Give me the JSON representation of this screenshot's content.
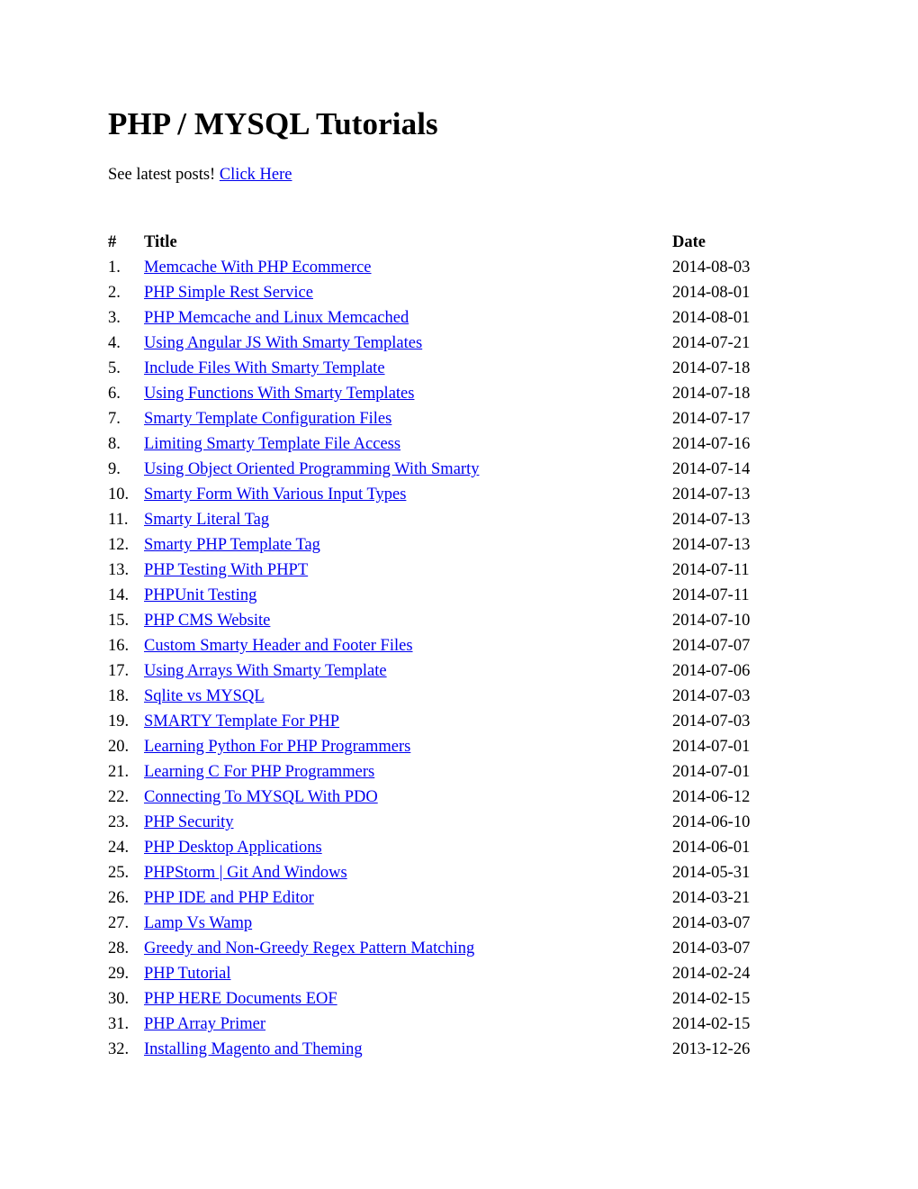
{
  "page": {
    "title": "PHP / MYSQL Tutorials",
    "subtitle_text": "See latest posts!",
    "subtitle_link_label": "Click Here"
  },
  "colors": {
    "link": "#0000EE",
    "text": "#000000",
    "background": "#FFFFFF"
  },
  "table": {
    "headers": {
      "num": "#",
      "title": "Title",
      "date": "Date"
    },
    "rows": [
      {
        "num": "1.",
        "title": "Memcache With PHP Ecommerce",
        "date": "2014-08-03"
      },
      {
        "num": "2.",
        "title": "PHP Simple Rest Service",
        "date": "2014-08-01"
      },
      {
        "num": "3.",
        "title": "PHP Memcache and Linux Memcached",
        "date": "2014-08-01"
      },
      {
        "num": "4.",
        "title": "Using Angular JS With Smarty Templates",
        "date": "2014-07-21"
      },
      {
        "num": "5.",
        "title": "Include Files With Smarty Template",
        "date": "2014-07-18"
      },
      {
        "num": "6.",
        "title": "Using Functions With Smarty Templates",
        "date": "2014-07-18"
      },
      {
        "num": "7.",
        "title": "Smarty Template Configuration Files",
        "date": "2014-07-17"
      },
      {
        "num": "8.",
        "title": "Limiting Smarty Template File Access",
        "date": "2014-07-16"
      },
      {
        "num": "9.",
        "title": "Using Object Oriented Programming With Smarty",
        "date": "2014-07-14"
      },
      {
        "num": "10.",
        "title": "Smarty Form With Various Input Types",
        "date": "2014-07-13"
      },
      {
        "num": "11.",
        "title": "Smarty Literal Tag",
        "date": "2014-07-13"
      },
      {
        "num": "12.",
        "title": "Smarty PHP Template Tag",
        "date": "2014-07-13"
      },
      {
        "num": "13.",
        "title": "PHP Testing With PHPT",
        "date": "2014-07-11"
      },
      {
        "num": "14.",
        "title": "PHPUnit Testing",
        "date": "2014-07-11"
      },
      {
        "num": "15.",
        "title": "PHP CMS Website",
        "date": "2014-07-10"
      },
      {
        "num": "16.",
        "title": "Custom Smarty Header and Footer Files",
        "date": "2014-07-07"
      },
      {
        "num": "17.",
        "title": "Using Arrays With Smarty Template",
        "date": "2014-07-06"
      },
      {
        "num": "18.",
        "title": "Sqlite vs MYSQL",
        "date": "2014-07-03"
      },
      {
        "num": "19.",
        "title": "SMARTY Template For PHP",
        "date": "2014-07-03"
      },
      {
        "num": "20.",
        "title": "Learning Python For PHP Programmers",
        "date": "2014-07-01"
      },
      {
        "num": "21.",
        "title": "Learning C For PHP Programmers",
        "date": "2014-07-01"
      },
      {
        "num": "22.",
        "title": "Connecting To MYSQL With PDO",
        "date": "2014-06-12"
      },
      {
        "num": "23.",
        "title": "PHP Security",
        "date": "2014-06-10"
      },
      {
        "num": "24.",
        "title": "PHP Desktop Applications",
        "date": "2014-06-01"
      },
      {
        "num": "25.",
        "title": "PHPStorm | Git And Windows",
        "date": "2014-05-31"
      },
      {
        "num": "26.",
        "title": "PHP IDE and PHP Editor",
        "date": "2014-03-21"
      },
      {
        "num": "27.",
        "title": "Lamp Vs Wamp",
        "date": "2014-03-07"
      },
      {
        "num": "28.",
        "title": "Greedy and Non-Greedy Regex Pattern Matching",
        "date": "2014-03-07"
      },
      {
        "num": "29.",
        "title": "PHP Tutorial",
        "date": "2014-02-24"
      },
      {
        "num": "30.",
        "title": "PHP HERE Documents EOF",
        "date": "2014-02-15"
      },
      {
        "num": "31.",
        "title": "PHP Array Primer",
        "date": "2014-02-15"
      },
      {
        "num": "32.",
        "title": "Installing Magento and Theming",
        "date": "2013-12-26"
      }
    ]
  }
}
